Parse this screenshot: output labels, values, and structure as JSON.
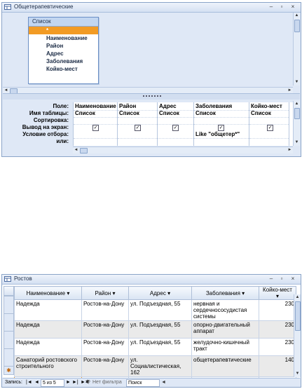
{
  "query_window": {
    "title": "Общетерапевтические",
    "controls": {
      "minimize": "–",
      "maximize": "▫",
      "close": "×"
    },
    "table": {
      "name": "Список",
      "fields": [
        "*",
        "Наименование",
        "Район",
        "Адрес",
        "Заболевания",
        "Койко-мест"
      ]
    },
    "row_labels": {
      "field": "Поле:",
      "table": "Имя таблицы:",
      "sort": "Сортировка:",
      "show": "Вывод на экран:",
      "criteria": "Условие отбора:",
      "or": "или:"
    },
    "columns": [
      {
        "field": "Наименование",
        "table": "Список",
        "show": true,
        "criteria": ""
      },
      {
        "field": "Район",
        "table": "Список",
        "show": true,
        "criteria": ""
      },
      {
        "field": "Адрес",
        "table": "Список",
        "show": true,
        "criteria": ""
      },
      {
        "field": "Заболевания",
        "table": "Список",
        "show": true,
        "criteria": "Like \"общетер*\""
      },
      {
        "field": "Койко-мест",
        "table": "Список",
        "show": true,
        "criteria": ""
      }
    ]
  },
  "datasheet_window": {
    "title": "Ростов",
    "controls": {
      "minimize": "–",
      "maximize": "▫",
      "close": "×"
    },
    "headers": [
      "Наименование",
      "Район",
      "Адрес",
      "Заболевания",
      "Койко-мест"
    ],
    "rows": [
      [
        "Надежда",
        "Ростов-на-Дону",
        "ул. Подъездная, 55",
        "нервная и сердечнососудистая системы",
        "230"
      ],
      [
        "Надежда",
        "Ростов-на-Дону",
        "ул. Подъездная, 55",
        "опорно-двигательный аппарат",
        "230"
      ],
      [
        "Надежда",
        "Ростов-на-Дону",
        "ул. Подъездная, 55",
        "желудочно-кишечный тракт",
        "230"
      ],
      [
        "Санаторий ростовского строительного",
        "Ростов-на-Дону",
        "ул. Социалистическая, 162",
        "общетерапевтические",
        "140"
      ]
    ],
    "new_row_marker": "✱",
    "nav": {
      "label": "Запись:",
      "current": "5 из 5",
      "filter": "Нет фильтра",
      "search": "Поиск"
    }
  }
}
